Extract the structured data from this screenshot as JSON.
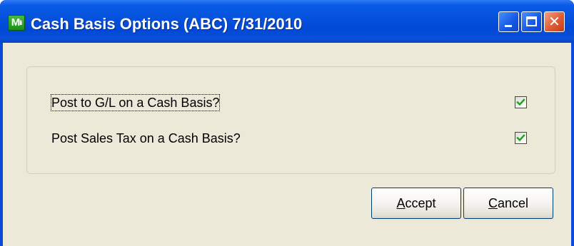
{
  "window": {
    "title": "Cash Basis Options (ABC) 7/31/2010",
    "icon": "app-icon",
    "icon_text_main": "M",
    "icon_text_sub": "li",
    "close_glyph": "✕"
  },
  "options": [
    {
      "label": "Post to G/L on a Cash Basis?",
      "checked": true
    },
    {
      "label": "Post Sales Tax on a Cash Basis?",
      "checked": true
    }
  ],
  "buttons": {
    "accept": {
      "mnemonic": "A",
      "rest": "ccept"
    },
    "cancel": {
      "mnemonic": "C",
      "rest": "ancel"
    }
  },
  "colors": {
    "titlebar": "#0552dc",
    "dialog_bg": "#ece9d8",
    "checkmark": "#21a121"
  }
}
